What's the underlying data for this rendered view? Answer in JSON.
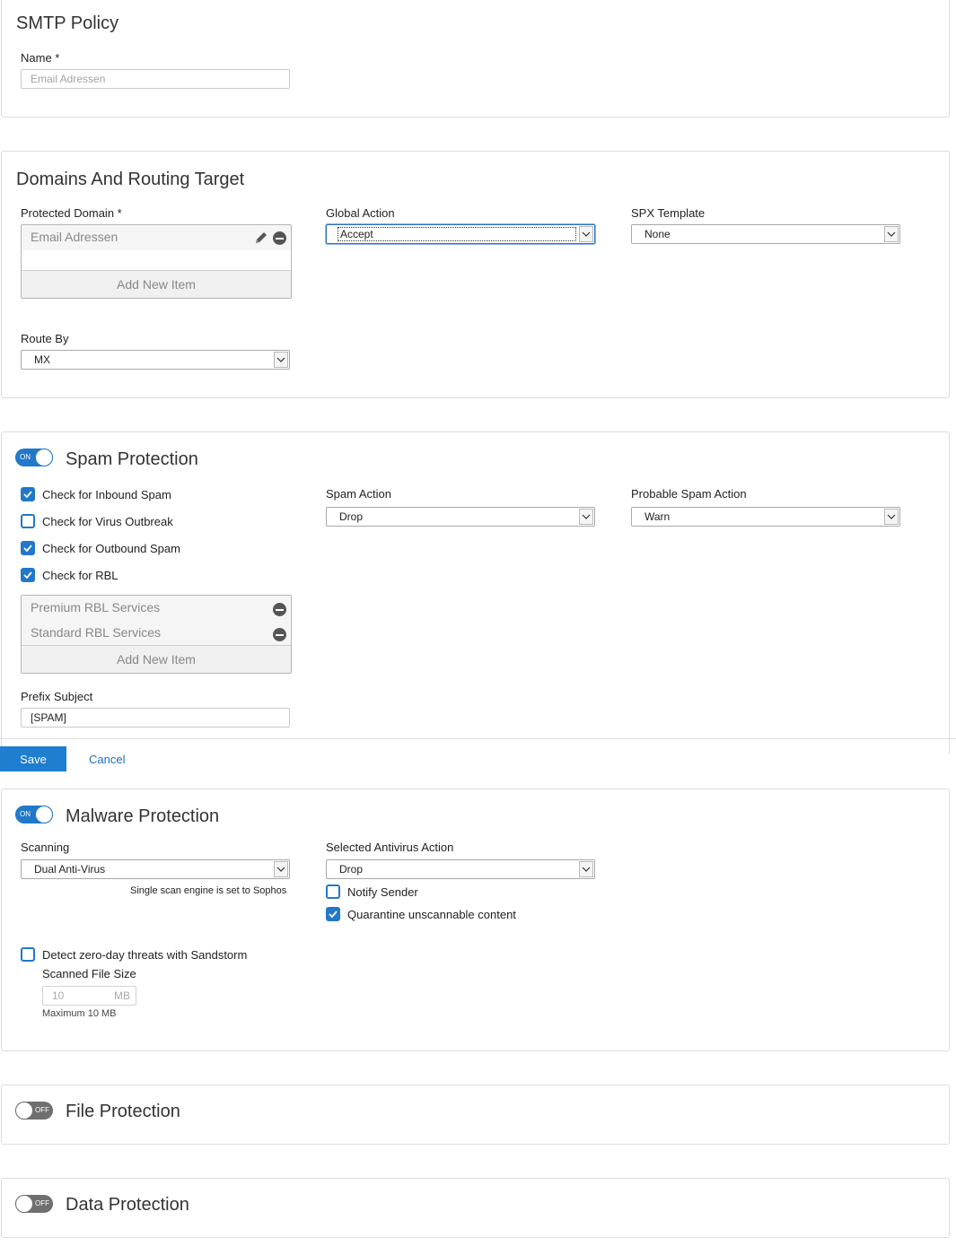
{
  "smtp": {
    "title": "SMTP Policy",
    "name_label": "Name *",
    "name_placeholder": "Email Adressen"
  },
  "domains": {
    "title": "Domains And Routing Target",
    "protected_label": "Protected Domain *",
    "protected_items": [
      "Email Adressen"
    ],
    "add_new": "Add New Item",
    "global_action_label": "Global Action",
    "global_action_value": "Accept",
    "spx_label": "SPX Template",
    "spx_value": "None",
    "route_label": "Route By",
    "route_value": "MX"
  },
  "spam": {
    "toggle_text": "ON",
    "title": "Spam Protection",
    "checks": [
      {
        "label": "Check for Inbound Spam",
        "checked": true
      },
      {
        "label": "Check for Virus Outbreak",
        "checked": false
      },
      {
        "label": "Check for Outbound Spam",
        "checked": true
      },
      {
        "label": "Check for RBL",
        "checked": true
      }
    ],
    "rbl_items": [
      "Premium RBL Services",
      "Standard RBL Services"
    ],
    "add_new": "Add New Item",
    "prefix_label": "Prefix Subject",
    "prefix_value": "[SPAM]",
    "spam_action_label": "Spam Action",
    "spam_action_value": "Drop",
    "probable_label": "Probable Spam Action",
    "probable_value": "Warn"
  },
  "actions": {
    "save": "Save",
    "cancel": "Cancel"
  },
  "malware": {
    "toggle_text": "ON",
    "title": "Malware Protection",
    "scanning_label": "Scanning",
    "scanning_value": "Dual Anti-Virus",
    "scan_note": "Single scan engine is set to Sophos",
    "av_label": "Selected Antivirus Action",
    "av_value": "Drop",
    "notify_label": "Notify Sender",
    "notify_checked": false,
    "quarantine_label": "Quarantine unscannable content",
    "quarantine_checked": true,
    "sandstorm_label": "Detect zero-day threats with Sandstorm",
    "sandstorm_checked": false,
    "file_size_label": "Scanned File Size",
    "file_size_value": "10",
    "file_size_unit": "MB",
    "file_size_max": "Maximum 10 MB"
  },
  "file": {
    "toggle_text": "OFF",
    "title": "File Protection"
  },
  "data": {
    "toggle_text": "OFF",
    "title": "Data Protection"
  }
}
